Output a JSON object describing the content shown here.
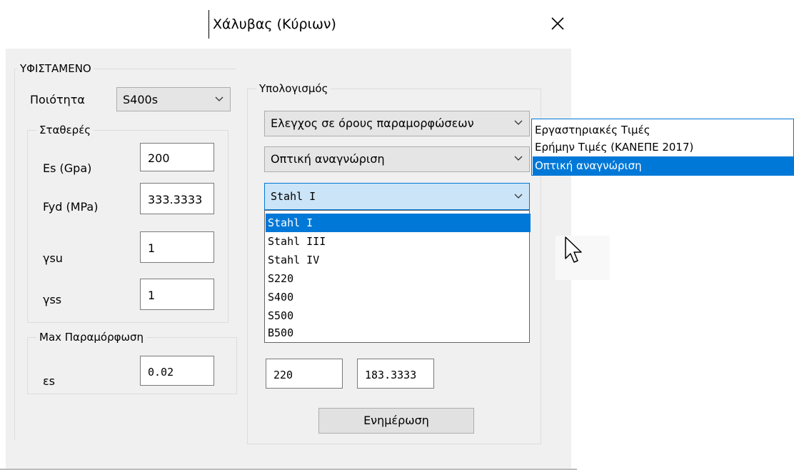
{
  "window": {
    "title": "Χάλυβας (Κύριων)"
  },
  "existing": {
    "group_label": "ΥΦΙΣΤΑΜΕΝΟ",
    "quality_label": "Ποιότητα",
    "quality_value": "S400s",
    "constants_label": "Σταθερές",
    "fields": [
      {
        "label": "Es (Gpa)",
        "value": "200"
      },
      {
        "label": "Fyd (MPa)",
        "value": "333.3333"
      },
      {
        "label": "γsu",
        "value": "1"
      },
      {
        "label": "γss",
        "value": "1"
      }
    ],
    "max_strain_label": "Max Παραμόρφωση",
    "es_label": "εs",
    "es_value": "0.02"
  },
  "calculation": {
    "group_label": "Υπολογισμός",
    "check_mode_value": "Ελεγχος σε όρους παραμορφώσεων",
    "source_value": "Οπτική αναγνώριση",
    "steel_value": "Stahl I",
    "bottom_value_1": "220",
    "bottom_value_2": "183.3333",
    "update_button": "Ενημέρωση"
  },
  "steel_dropdown": {
    "options": [
      "Stahl I",
      "Stahl III",
      "Stahl IV",
      "S220",
      "S400",
      "S500",
      "B500"
    ],
    "selected_index": 0
  },
  "source_dropdown": {
    "options": [
      "Εργαστηριακές Τιμές",
      "Ερήμην Τιμές (ΚΑΝΕΠΕ 2017)",
      "Οπτική αναγνώριση"
    ],
    "selected_index": 2
  },
  "icons": {
    "close": "close-icon",
    "chevron": "chevron-down-icon",
    "cursor": "mouse-pointer-icon"
  },
  "colors": {
    "selection": "#0078d7",
    "focus_fill": "#cce4f7",
    "dialog_bg": "#f0f0f0"
  }
}
